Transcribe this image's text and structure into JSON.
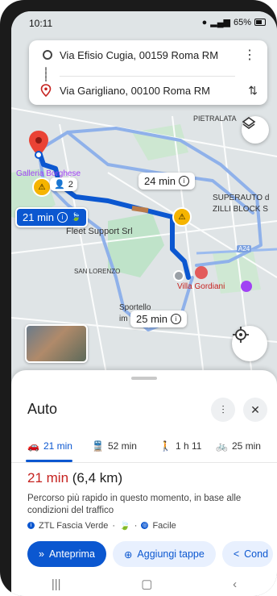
{
  "status_bar": {
    "time": "10:11",
    "battery": "65%"
  },
  "route_card": {
    "origin": "Via Efisio Cugia, 00159 Roma RM",
    "destination": "Via Garigliano, 00100 Roma RM"
  },
  "map": {
    "labels": {
      "pietralata": "PIETRALATA",
      "galleria": "Galleria Borghese",
      "superauto_1": "SUPERAUTO d",
      "superauto_2": "ZILLI BLOCK S",
      "fleet": "Fleet Support Srl",
      "san_lorenzo": "SAN LORENZO",
      "villa": "Villa Gordiani",
      "sportello_1": "Sportello",
      "sportello_2": "im",
      "a24": "A24"
    },
    "incident_count": "2",
    "route_times": {
      "main": "21 min",
      "alt1": "24 min",
      "alt2": "25 min"
    }
  },
  "sheet": {
    "title": "Auto",
    "modes": [
      {
        "label": "21 min",
        "icon": "car-icon"
      },
      {
        "label": "52 min",
        "icon": "transit-icon"
      },
      {
        "label": "1 h 11",
        "icon": "walk-icon"
      },
      {
        "label": "25 min",
        "icon": "bike-icon"
      }
    ],
    "duration": "21 min",
    "distance": "(6,4 km)",
    "description": "Percorso più rapido in questo momento, in base alle condizioni del traffico",
    "chips": {
      "ztl": "ZTL Fascia Verde",
      "easy": "Facile",
      "sep": "·"
    },
    "buttons": {
      "preview": "Anteprima",
      "add_stops": "Aggiungi tappe",
      "share": "Cond"
    }
  },
  "colors": {
    "accent": "#0b57d0",
    "duration_red": "#c5221f",
    "incident": "#f5b400"
  }
}
